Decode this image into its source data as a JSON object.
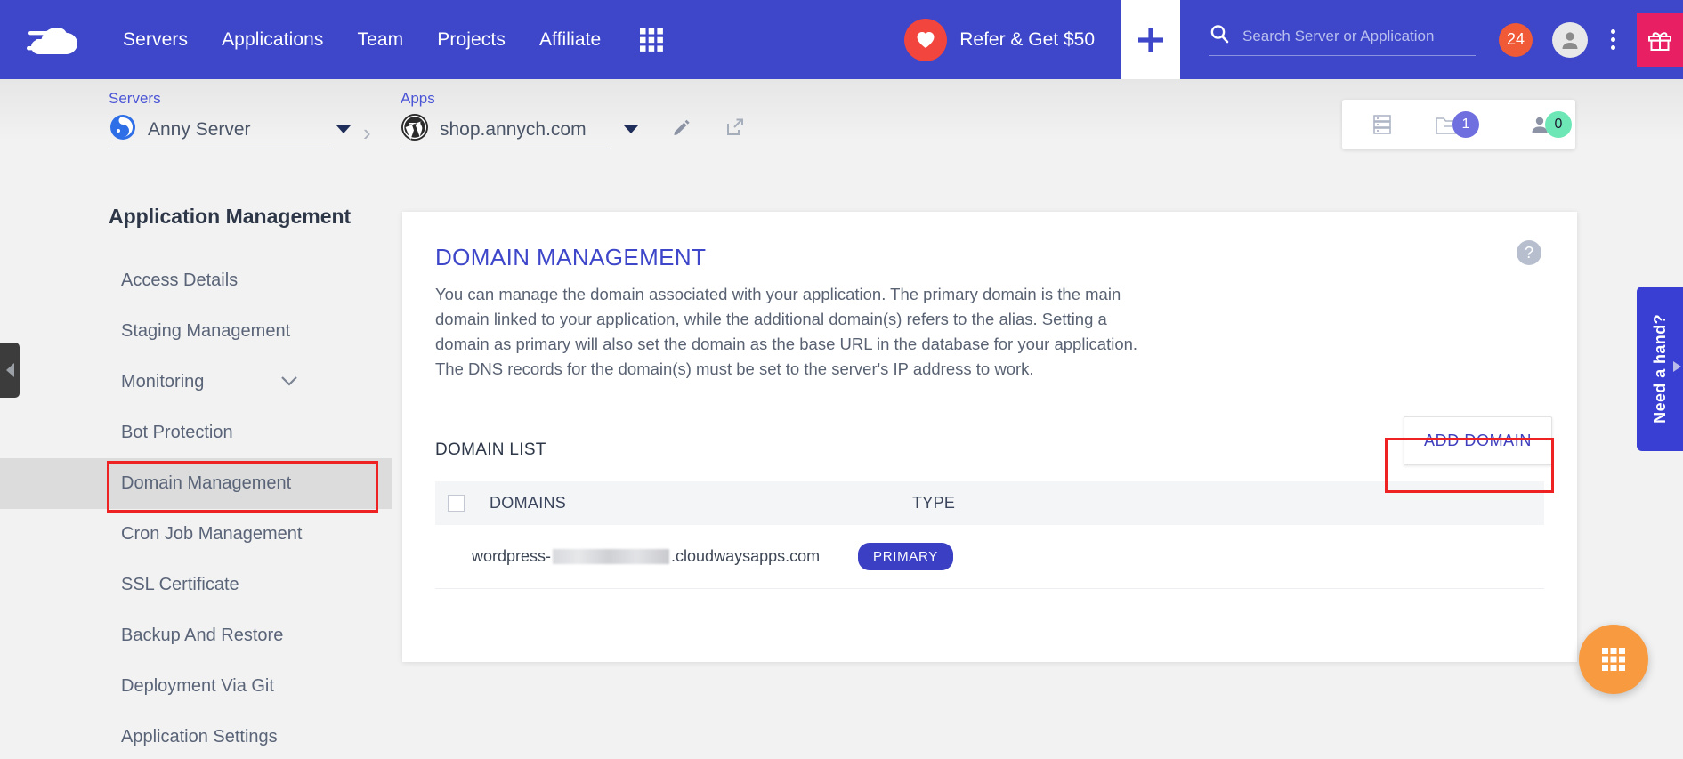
{
  "topnav": {
    "logo_name": "cloudways-logo",
    "links": [
      {
        "label": "Servers"
      },
      {
        "label": "Applications"
      },
      {
        "label": "Team"
      },
      {
        "label": "Projects"
      },
      {
        "label": "Affiliate"
      }
    ],
    "grid_icon": "apps-grid-icon",
    "refer_label": "Refer & Get $50",
    "heart_icon": "heart-icon",
    "plus_icon": "plus-icon",
    "search": {
      "placeholder": "Search Server or Application",
      "value": "",
      "icon": "search-icon"
    },
    "notification_count": "24",
    "avatar_icon": "user-avatar-icon",
    "kebab_icon": "more-vertical-icon",
    "gift_icon": "gift-icon",
    "colors": {
      "nav_bg": "#3e47c9",
      "heart": "#f2453d",
      "badge": "#f05a36",
      "gift": "#e81f63"
    }
  },
  "breadcrumb": {
    "servers": {
      "label": "Servers",
      "name": "Anny Server",
      "icon": "server-cloud-icon"
    },
    "separator": "›",
    "apps": {
      "label": "Apps",
      "name": "shop.annych.com",
      "icon": "wordpress-icon"
    },
    "edit_icon": "pencil-edit-icon",
    "launch_icon": "external-link-icon"
  },
  "status_panel": {
    "items": [
      {
        "icon": "server-stack-icon",
        "count": ""
      },
      {
        "icon": "folder-icon",
        "count": "1",
        "badge_color": "#6f6fe0"
      },
      {
        "icon": "user-icon",
        "count": "0",
        "badge_color": "#6ee7b7"
      }
    ]
  },
  "sidebar": {
    "title": "Application Management",
    "items": [
      {
        "label": "Access Details",
        "active": false,
        "chevron": false
      },
      {
        "label": "Staging Management",
        "active": false,
        "chevron": false
      },
      {
        "label": "Monitoring",
        "active": false,
        "chevron": true
      },
      {
        "label": "Bot Protection",
        "active": false,
        "chevron": false
      },
      {
        "label": "Domain Management",
        "active": true,
        "chevron": false
      },
      {
        "label": "Cron Job Management",
        "active": false,
        "chevron": false
      },
      {
        "label": "SSL Certificate",
        "active": false,
        "chevron": false
      },
      {
        "label": "Backup And Restore",
        "active": false,
        "chevron": false
      },
      {
        "label": "Deployment Via Git",
        "active": false,
        "chevron": false
      },
      {
        "label": "Application Settings",
        "active": false,
        "chevron": false
      }
    ]
  },
  "card": {
    "title": "DOMAIN MANAGEMENT",
    "help_icon": "help-circle-icon",
    "description": "You can manage the domain associated with your application. The primary domain is the main domain linked to your application, while the additional domain(s) refers to the alias. Setting a domain as primary will also set the domain as the base URL in the database for your application. The DNS records for the domain(s) must be set to the server's IP address to work.",
    "list_heading": "DOMAIN LIST",
    "add_button": "ADD DOMAIN",
    "table": {
      "columns": [
        "DOMAINS",
        "TYPE"
      ],
      "select_all_checked": false,
      "rows": [
        {
          "domain_prefix": "wordpress-",
          "domain_redacted": true,
          "domain_suffix": ".cloudwaysapps.com",
          "type": "PRIMARY"
        }
      ]
    }
  },
  "widgets": {
    "need_hand": "Need a hand?",
    "need_hand_icon": "play-arrow-icon",
    "fab_icon": "apps-grid-icon",
    "collapse_handle_icon": "triangle-left-icon",
    "fab_color": "#f89a3f"
  }
}
